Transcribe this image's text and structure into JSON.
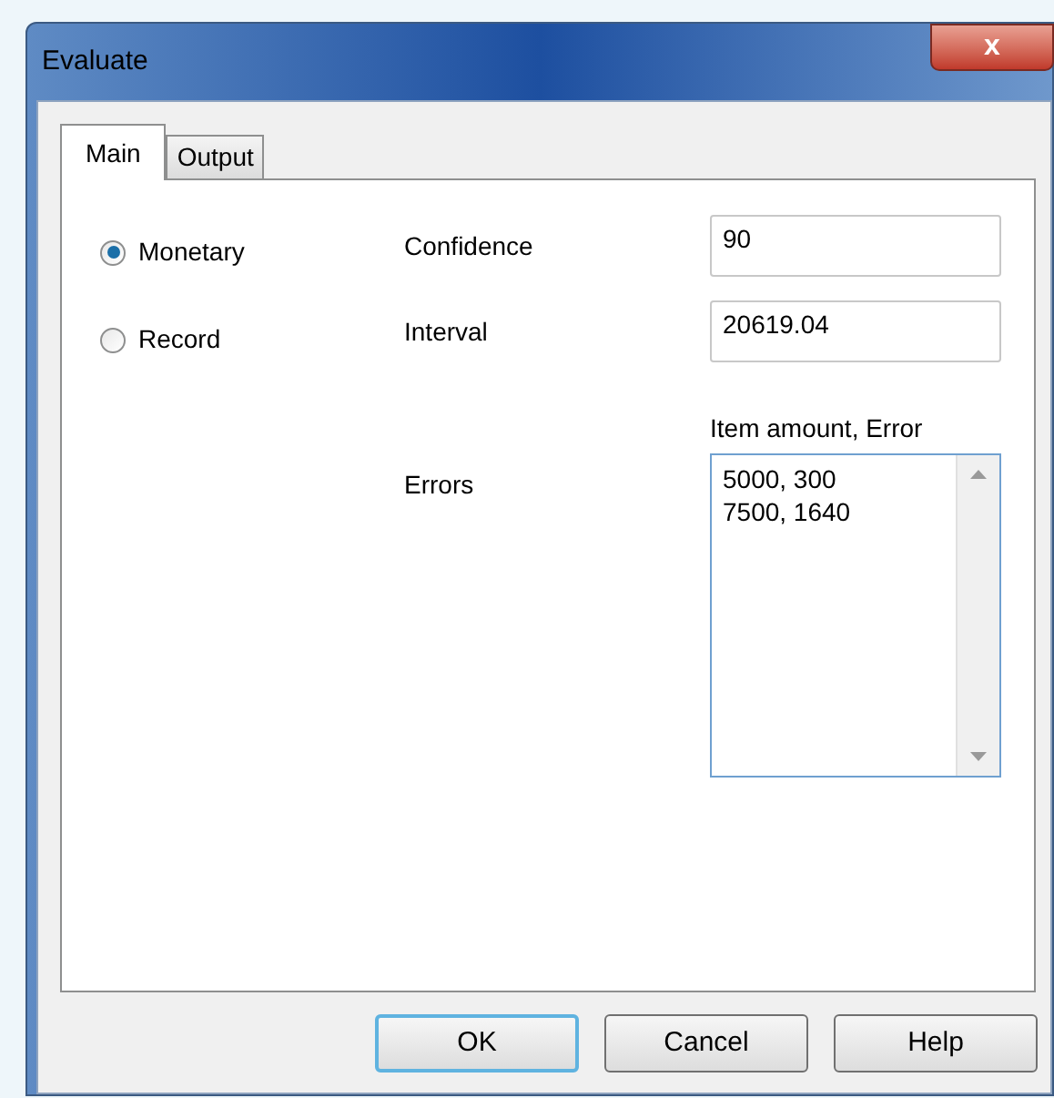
{
  "window": {
    "title": "Evaluate",
    "close": "x"
  },
  "tabs": [
    {
      "label": "Main",
      "selected": true
    },
    {
      "label": "Output",
      "selected": false
    }
  ],
  "type_options": [
    {
      "label": "Monetary",
      "selected": true
    },
    {
      "label": "Record",
      "selected": false
    }
  ],
  "fields": [
    {
      "label": "Confidence",
      "value": "90"
    },
    {
      "label": "Interval",
      "value": "20619.04"
    }
  ],
  "errors": {
    "hint": "Item amount, Error",
    "label": "Errors",
    "value": "5000, 300\n7500, 1640"
  },
  "buttons": [
    {
      "label": "OK",
      "default": true
    },
    {
      "label": "Cancel",
      "default": false
    },
    {
      "label": "Help",
      "default": false
    }
  ]
}
